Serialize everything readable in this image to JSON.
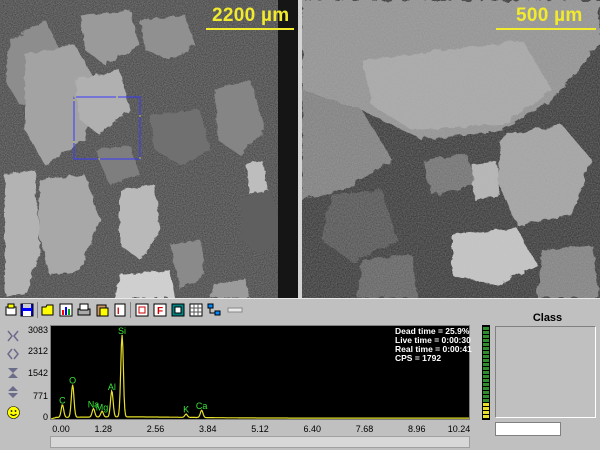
{
  "images": {
    "left": {
      "scale_label": "2200 µm"
    },
    "right": {
      "scale_label": "500 µm"
    }
  },
  "toolbar": {
    "icons": [
      "print-preview-icon",
      "save-icon",
      "open-icon",
      "chart-icon",
      "printer-icon",
      "paste-icon",
      "text-report-icon",
      "frame-icon",
      "f-filter-icon",
      "stop-icon",
      "grid-icon",
      "network-icon",
      "minimize-icon"
    ]
  },
  "side_controls": [
    "zoom-fit-icon",
    "horizontal-expand-icon",
    "vertical-expand-icon",
    "up-down-icon",
    "smiley-icon"
  ],
  "chart_data": {
    "type": "line",
    "xlabel": "",
    "ylabel": "",
    "x_ticks": [
      "0.00",
      "1.28",
      "2.56",
      "3.84",
      "5.12",
      "6.40",
      "7.68",
      "8.96",
      "10.24"
    ],
    "y_ticks": [
      "3083",
      "2312",
      "1542",
      "771",
      "0"
    ],
    "xlim": [
      0,
      10.24
    ],
    "ylim": [
      0,
      3083
    ],
    "peaks": [
      {
        "label": "C",
        "x": 0.28,
        "y": 420
      },
      {
        "label": "O",
        "x": 0.53,
        "y": 1080
      },
      {
        "label": "Na",
        "x": 1.04,
        "y": 280
      },
      {
        "label": "Mg",
        "x": 1.25,
        "y": 190
      },
      {
        "label": "Al",
        "x": 1.49,
        "y": 870
      },
      {
        "label": "Si",
        "x": 1.74,
        "y": 2720
      },
      {
        "label": "K",
        "x": 3.31,
        "y": 110
      },
      {
        "label": "Ca",
        "x": 3.69,
        "y": 240
      }
    ],
    "line_color": "#e6e028",
    "label_color": "#39e639"
  },
  "stats": {
    "dead_time": "Dead time = 25.9%",
    "live_time": "Live time = 0:00:30",
    "real_time": "Real time = 0:00:41",
    "cps": "CPS = 1792"
  },
  "class_panel": {
    "title": "Class",
    "input_value": ""
  }
}
